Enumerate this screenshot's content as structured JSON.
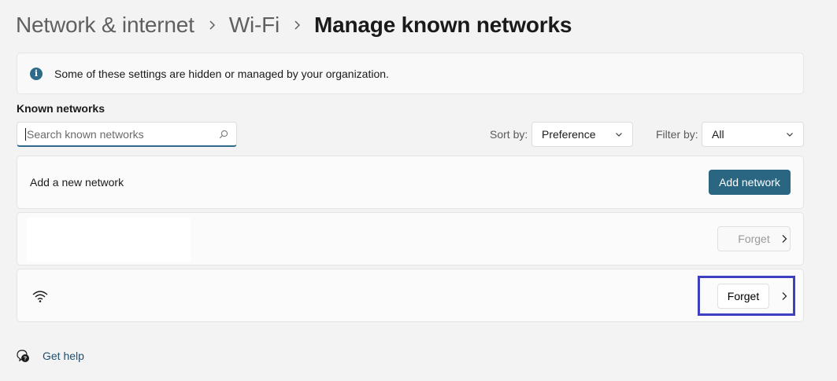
{
  "breadcrumb": {
    "items": [
      "Network & internet",
      "Wi-Fi"
    ],
    "current": "Manage known networks"
  },
  "info": {
    "text": "Some of these settings are hidden or managed by your organization."
  },
  "known_networks": {
    "title": "Known networks",
    "search": {
      "placeholder": "Search known networks",
      "value": ""
    },
    "sort": {
      "label": "Sort by:",
      "value": "Preference"
    },
    "filter": {
      "label": "Filter by:",
      "value": "All"
    }
  },
  "add_network": {
    "label": "Add a new network",
    "button": "Add network"
  },
  "networks": [
    {
      "name": "",
      "forget_label": "Forget",
      "forget_enabled": false
    },
    {
      "name": "",
      "forget_label": "Forget",
      "forget_enabled": true,
      "icon": "wifi-icon"
    }
  ],
  "help": {
    "label": "Get help"
  },
  "colors": {
    "accent": "#2a6682",
    "highlight": "#3b3fc0"
  }
}
